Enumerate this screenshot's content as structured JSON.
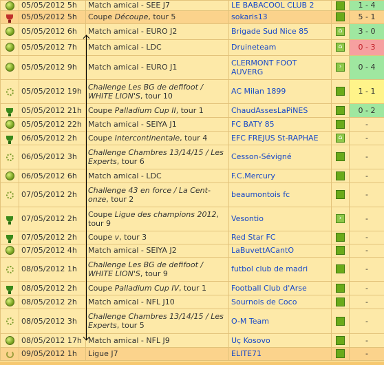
{
  "rows": [
    {
      "icon": "ball",
      "date": "05/05/2012 5h",
      "event": "Match amical - SEE J7",
      "team": "LE BABACOOL CLUB 2",
      "action": "square",
      "score": "1 - 4",
      "score_class": "green",
      "hl": false,
      "h": 14
    },
    {
      "icon": "cup-red",
      "date": "05/05/2012 5h",
      "event": "Coupe <i>Découpe</i>, tour 5",
      "team": "sokaris13",
      "action": "square",
      "score": "5 - 1",
      "score_class": "green",
      "hl": true,
      "h": 19
    },
    {
      "icon": "ball",
      "date": "05/05/2012 6h",
      "event": "Match amical - EURO J2",
      "team": "Brigade Sud Nice 85",
      "action": "home",
      "score": "3 - 0",
      "score_class": "green",
      "hl": false,
      "h": 23
    },
    {
      "icon": "ball",
      "date": "05/05/2012 7h",
      "event": "Match amical - LDC",
      "team": "Druineteam",
      "action": "home",
      "score": "0 - 3",
      "score_class": "red",
      "hl": false,
      "h": 23
    },
    {
      "icon": "ball",
      "date": "05/05/2012 9h",
      "event": "Match amical - EURO J1",
      "team": "CLERMONT FOOT AUVERG",
      "action": "arrow",
      "score": "0 - 4",
      "score_class": "green",
      "hl": false,
      "h": 35
    },
    {
      "icon": "chal",
      "date": "05/05/2012 19h",
      "event": "<i>Challenge Les BG de defifoot / WHITE LION'S</i>, tour 10",
      "team": "AC Milan 1899",
      "action": "square",
      "score": "1 - 1",
      "score_class": "yellow",
      "hl": false,
      "h": 35
    },
    {
      "icon": "cup",
      "date": "05/05/2012 21h",
      "event": "Coupe <i>Palladium Cup II</i>, tour 1",
      "team": "ChaudAssesLaPiNES",
      "action": "square",
      "score": "0 - 2",
      "score_class": "green",
      "hl": false,
      "h": 20
    },
    {
      "icon": "ball",
      "date": "05/05/2012 22h",
      "event": "Match amical - SEIYA J1",
      "team": "FC BATY 85",
      "action": "square",
      "score": "-",
      "score_class": "",
      "hl": false,
      "h": 20
    },
    {
      "icon": "cup",
      "date": "06/05/2012 2h",
      "event": "Coupe <i>Intercontinentale</i>, tour 4",
      "team": "EFC FREJUS St-RAPHAE",
      "action": "home",
      "score": "-",
      "score_class": "",
      "hl": false,
      "h": 20
    },
    {
      "icon": "chal",
      "date": "06/05/2012 3h",
      "event": "<i>Challenge Chambres 13/14/15 / Les Experts</i>, tour 6",
      "team": "Cesson-Sévigné",
      "action": "square",
      "score": "-",
      "score_class": "",
      "hl": false,
      "h": 35
    },
    {
      "icon": "ball",
      "date": "06/05/2012 6h",
      "event": "Match amical - LDC",
      "team": "F.C.Mercury",
      "action": "square",
      "score": "-",
      "score_class": "",
      "hl": false,
      "h": 20
    },
    {
      "icon": "chal",
      "date": "07/05/2012 2h",
      "event": "<i>Challenge 43 en force / La Cent-onze</i>, tour 2",
      "team": "beaumontois fc",
      "action": "square",
      "score": "-",
      "score_class": "",
      "hl": false,
      "h": 35
    },
    {
      "icon": "cup",
      "date": "07/05/2012 2h",
      "event": "Coupe <i>Ligue des champions 2012</i>, tour 9",
      "team": "Vesontio",
      "action": "arrow",
      "score": "-",
      "score_class": "",
      "hl": false,
      "h": 35
    },
    {
      "icon": "cup",
      "date": "07/05/2012 2h",
      "event": "Coupe <i>v</i>, tour 3",
      "team": "Red Star FC",
      "action": "square",
      "score": "-",
      "score_class": "",
      "hl": false,
      "h": 19
    },
    {
      "icon": "ball",
      "date": "07/05/2012 4h",
      "event": "Match amical - SEIYA J2",
      "team": "LaBuvettACantO",
      "action": "square",
      "score": "-",
      "score_class": "",
      "hl": false,
      "h": 19
    },
    {
      "icon": "chal",
      "date": "08/05/2012 1h",
      "event": "<i>Challenge Les BG de defifoot / WHITE LION'S</i>, tour 9",
      "team": "futbol club de madri",
      "action": "square",
      "score": "-",
      "score_class": "",
      "hl": false,
      "h": 35
    },
    {
      "icon": "cup",
      "date": "08/05/2012 2h",
      "event": "Coupe <i>Palladium Cup IV</i>, tour 1",
      "team": "Football Club d'Arse",
      "action": "square",
      "score": "-",
      "score_class": "",
      "hl": false,
      "h": 20
    },
    {
      "icon": "ball",
      "date": "08/05/2012 2h",
      "event": "Match amical - NFL J10",
      "team": "Sournois de Coco",
      "action": "square",
      "score": "-",
      "score_class": "",
      "hl": false,
      "h": 20
    },
    {
      "icon": "chal",
      "date": "08/05/2012 3h",
      "event": "<i>Challenge Chambres 13/14/15 / Les Experts</i>, tour 5",
      "team": "O-M Team",
      "action": "square",
      "score": "-",
      "score_class": "",
      "hl": false,
      "h": 36
    },
    {
      "icon": "ball",
      "date": "08/05/2012 17h",
      "event": "Match amical - NFL J9",
      "team": "Uç Kosovo",
      "action": "square",
      "score": "-",
      "score_class": "",
      "hl": false,
      "h": 20
    },
    {
      "icon": "laurel",
      "date": "09/05/2012 1h",
      "event": "Ligue J7",
      "team": "ELITE71",
      "action": "square",
      "score": "-",
      "score_class": "",
      "hl": true,
      "h": 19
    }
  ]
}
